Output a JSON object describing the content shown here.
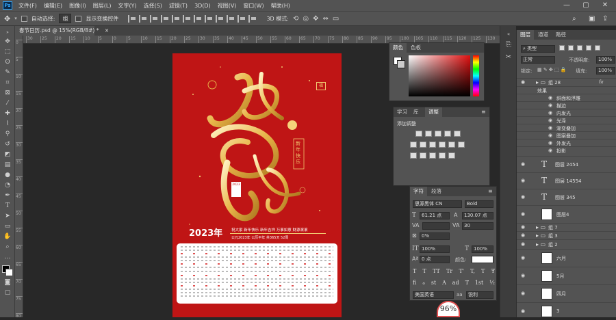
{
  "app": {
    "logo": "Ps",
    "menus": [
      "文件(F)",
      "编辑(E)",
      "图像(I)",
      "图层(L)",
      "文字(Y)",
      "选择(S)",
      "滤镜(T)",
      "3D(D)",
      "视图(V)",
      "窗口(W)",
      "帮助(H)"
    ],
    "win_min": "—",
    "win_max": "▢",
    "win_close": "✕"
  },
  "options": {
    "auto_select": "自动选择:",
    "auto_select_value": "组",
    "show_transform": "显示变换控件",
    "mode_3d": "3D 模式:"
  },
  "doc_tab": {
    "title": "春节日历.psd @ 15%(RGB/8#) *",
    "close": "×"
  },
  "ruler_h": [
    "30",
    "25",
    "20",
    "15",
    "10",
    "5",
    "0",
    "5",
    "10",
    "15",
    "20",
    "25",
    "30",
    "35",
    "40",
    "45",
    "50",
    "55",
    "60",
    "65",
    "70",
    "75",
    "80",
    "85",
    "90",
    "95",
    "100",
    "105",
    "110",
    "115",
    "120",
    "125",
    "130"
  ],
  "ruler_v": [
    "0",
    "5",
    "10",
    "15",
    "20",
    "25",
    "30",
    "35",
    "40",
    "45",
    "50",
    "55",
    "60",
    "65",
    "70",
    "75",
    "80"
  ],
  "poster": {
    "year": "2023年",
    "side_text": "新年快乐",
    "stamp": "福",
    "days_label": "2023",
    "greetings": "祝大家 新年快乐 新年吉祥 万事如意 财源滚滚",
    "info": "公元2023年 公历平年 共365天 52周",
    "hash": "#"
  },
  "color_panel": {
    "tab1": "颜色",
    "tab2": "色板"
  },
  "adjust_panel": {
    "tab1": "学习",
    "tab2": "库",
    "tab3": "调整",
    "add": "添加调整"
  },
  "char_panel": {
    "tab1": "字符",
    "tab2": "段落",
    "font": "思源黑体 CN",
    "weight": "Bold",
    "size": "61.21 点",
    "leading": "130.07 点",
    "tracking": "30",
    "kerning": "0%",
    "scale_v": "100%",
    "scale_h": "100%",
    "baseline": "0 点",
    "color_label": "颜色:",
    "lang": "美国英语",
    "aa_label": "aa",
    "aa": "锐利",
    "styles": [
      "T",
      "T",
      "TT",
      "Tr",
      "T'",
      "T,",
      "T",
      "Ŧ"
    ],
    "ot": [
      "fi",
      "ℴ",
      "st",
      "A",
      "ad",
      "T",
      "1st",
      "½"
    ]
  },
  "layers_panel": {
    "tab1": "图层",
    "tab2": "通道",
    "tab3": "路径",
    "filter": "类型",
    "blend": "正常",
    "opacity_label": "不透明度:",
    "opacity": "100%",
    "lock": "锁定:",
    "fill_label": "填充:",
    "fill": "100%",
    "items": [
      {
        "name": "组 28",
        "kind": "group"
      },
      {
        "name": "效果",
        "kind": "fx"
      },
      {
        "name": "斜面和浮雕",
        "kind": "fx"
      },
      {
        "name": "描边",
        "kind": "fx"
      },
      {
        "name": "内发光",
        "kind": "fx"
      },
      {
        "name": "光泽",
        "kind": "fx"
      },
      {
        "name": "渐变叠加",
        "kind": "fx"
      },
      {
        "name": "图案叠加",
        "kind": "fx"
      },
      {
        "name": "外发光",
        "kind": "fx"
      },
      {
        "name": "投影",
        "kind": "fx"
      },
      {
        "name": "图层 2454",
        "kind": "text"
      },
      {
        "name": "图层 14554",
        "kind": "text"
      },
      {
        "name": "图层 345",
        "kind": "text"
      },
      {
        "name": "图层4",
        "kind": "pixel"
      },
      {
        "name": "组 7",
        "kind": "group"
      },
      {
        "name": "组 3",
        "kind": "group"
      },
      {
        "name": "组 2",
        "kind": "group"
      },
      {
        "name": "六月",
        "kind": "pixel"
      },
      {
        "name": "5月",
        "kind": "pixel"
      },
      {
        "name": "四月",
        "kind": "pixel"
      },
      {
        "name": "3",
        "kind": "pixel"
      }
    ]
  },
  "zoom": "96%",
  "colors": {
    "poster_red": "#bf1515",
    "gold": "#e8b54a",
    "accent": "#e05050"
  }
}
